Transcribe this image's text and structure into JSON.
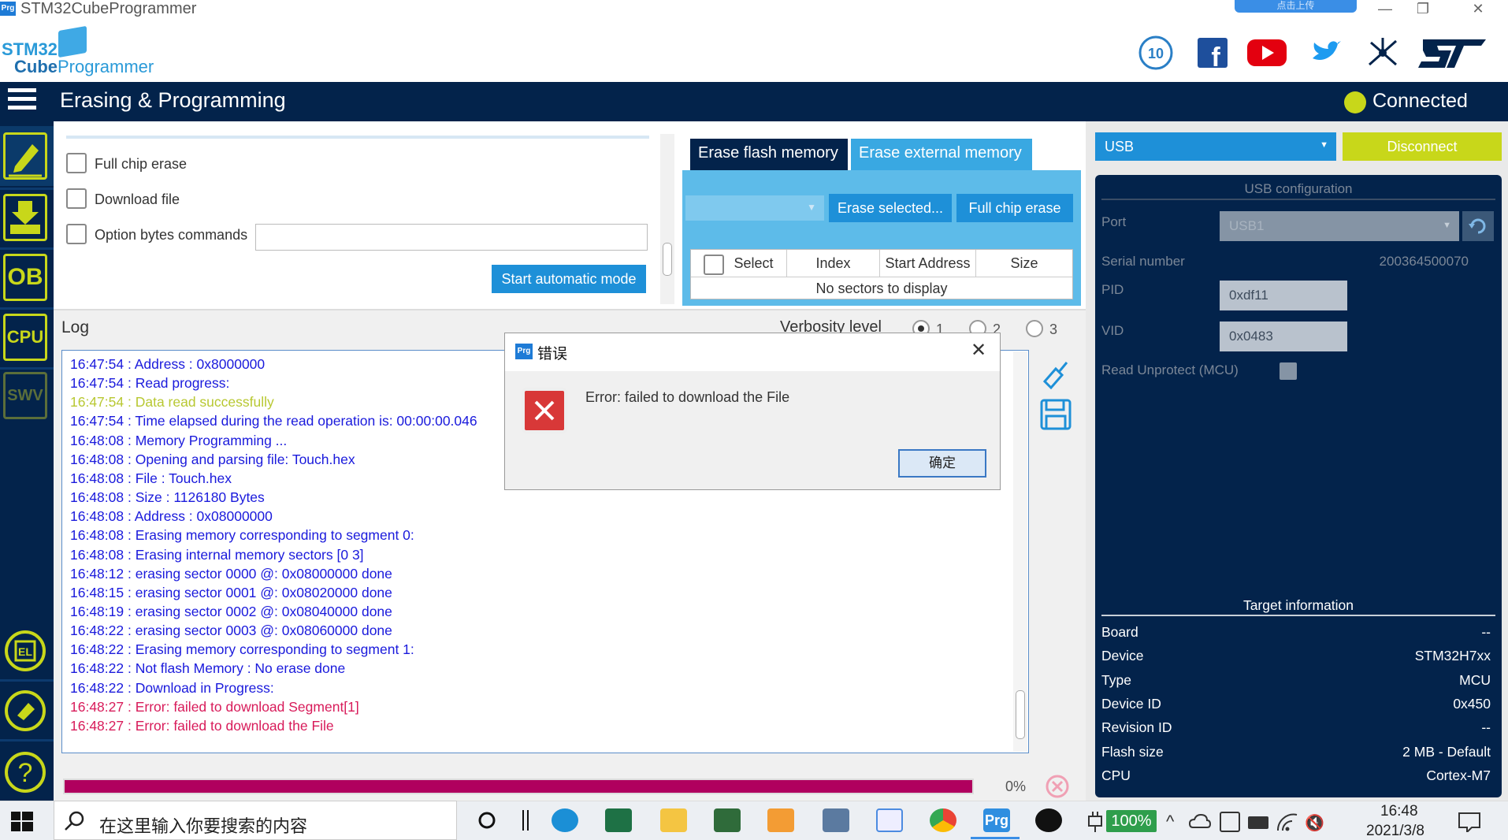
{
  "window": {
    "title": "STM32CubeProgrammer",
    "icon_label": "Prg",
    "cloud_badge": "点击上传"
  },
  "logo": {
    "line1": "STM32",
    "line2_bold": "Cube",
    "line2_rest": "Programmer"
  },
  "header_icons": [
    "anniversary-10-icon",
    "facebook-icon",
    "youtube-icon",
    "twitter-icon",
    "network-icon",
    "st-logo-icon"
  ],
  "navbar": {
    "title": "Erasing & Programming",
    "status": "Connected"
  },
  "sidebar": [
    {
      "name": "edit",
      "label": ""
    },
    {
      "name": "download",
      "label": ""
    },
    {
      "name": "ob",
      "label": "OB"
    },
    {
      "name": "cpu",
      "label": "CPU"
    },
    {
      "name": "swv",
      "label": "SWV"
    },
    {
      "name": "el",
      "label": "EL"
    },
    {
      "name": "eraser",
      "label": ""
    },
    {
      "name": "help",
      "label": "?"
    }
  ],
  "auto": {
    "full_chip_erase": "Full chip erase",
    "download_file": "Download file",
    "option_bytes": "Option bytes commands",
    "start_button": "Start automatic mode"
  },
  "erase": {
    "tab_flash": "Erase flash memory",
    "tab_external": "Erase external memory",
    "erase_selected": "Erase selected...",
    "full_chip_erase": "Full chip erase",
    "columns": [
      "Select",
      "Index",
      "Start Address",
      "Size"
    ],
    "empty_text": "No sectors to display"
  },
  "log": {
    "title": "Log",
    "verbosity_label": "Verbosity level",
    "levels": [
      "1",
      "2",
      "3"
    ],
    "selected_level": "1",
    "lines": [
      {
        "text": "16:47:54 :   Address       : 0x8000000",
        "color": "#1a1adc"
      },
      {
        "text": "16:47:54 : Read progress:",
        "color": "#1a1adc"
      },
      {
        "text": "16:47:54 : Data read successfully",
        "color": "#b8c832"
      },
      {
        "text": "16:47:54 : Time elapsed during the read operation is: 00:00:00.046",
        "color": "#1a1adc"
      },
      {
        "text": "16:48:08 : Memory Programming ...",
        "color": "#1a1adc"
      },
      {
        "text": "16:48:08 : Opening and parsing file: Touch.hex",
        "color": "#1a1adc"
      },
      {
        "text": "16:48:08 :   File          : Touch.hex",
        "color": "#1a1adc"
      },
      {
        "text": "16:48:08 :   Size          : 1126180 Bytes",
        "color": "#1a1adc"
      },
      {
        "text": "16:48:08 :   Address       : 0x08000000",
        "color": "#1a1adc"
      },
      {
        "text": "16:48:08 : Erasing memory corresponding to segment 0:",
        "color": "#1a1adc"
      },
      {
        "text": "16:48:08 : Erasing internal memory sectors [0 3]",
        "color": "#1a1adc"
      },
      {
        "text": "16:48:12 : erasing sector 0000 @: 0x08000000 done",
        "color": "#1a1adc"
      },
      {
        "text": "16:48:15 : erasing sector 0001 @: 0x08020000 done",
        "color": "#1a1adc"
      },
      {
        "text": "16:48:19 : erasing sector 0002 @: 0x08040000 done",
        "color": "#1a1adc"
      },
      {
        "text": "16:48:22 : erasing sector 0003 @: 0x08060000 done",
        "color": "#1a1adc"
      },
      {
        "text": "16:48:22 : Erasing memory corresponding to segment 1:",
        "color": "#1a1adc"
      },
      {
        "text": "16:48:22 : Not flash Memory : No erase done",
        "color": "#1a1adc"
      },
      {
        "text": "16:48:22 : Download in Progress:",
        "color": "#1a1adc"
      },
      {
        "text": "16:48:27 : Error: failed to download Segment[1]",
        "color": "#d81b5a"
      },
      {
        "text": "16:48:27 : Error: failed to download the File",
        "color": "#d81b5a"
      }
    ],
    "progress_fraction": 1.0,
    "progress_text": "0%"
  },
  "connection": {
    "interface": "USB",
    "disconnect": "Disconnect",
    "config_title": "USB configuration",
    "port_label": "Port",
    "port_value": "USB1",
    "serial_label": "Serial number",
    "serial_value": "200364500070",
    "pid_label": "PID",
    "pid_value": "0xdf11",
    "vid_label": "VID",
    "vid_value": "0x0483",
    "read_unprotect": "Read Unprotect (MCU)"
  },
  "target": {
    "title": "Target information",
    "rows": [
      {
        "label": "Board",
        "value": "--"
      },
      {
        "label": "Device",
        "value": "STM32H7xx"
      },
      {
        "label": "Type",
        "value": "MCU"
      },
      {
        "label": "Device ID",
        "value": "0x450"
      },
      {
        "label": "Revision ID",
        "value": "--"
      },
      {
        "label": "Flash size",
        "value": "2 MB - Default"
      },
      {
        "label": "CPU",
        "value": "Cortex-M7"
      }
    ]
  },
  "dialog": {
    "icon_label": "Prg",
    "title": "错误",
    "message": "Error: failed to download the File",
    "ok": "确定"
  },
  "taskbar": {
    "search_placeholder": "在这里输入你要搜索的内容",
    "battery": "100%",
    "time": "16:48",
    "date": "2021/3/8",
    "apps": [
      "cortana-icon",
      "task-view-icon",
      "edge-icon",
      "excel-icon",
      "explorer-icon",
      "vs-icon",
      "pdf-icon",
      "calculator-icon",
      "photos-icon",
      "chrome-icon",
      "prg-icon",
      "app-icon"
    ]
  },
  "colors": {
    "navy": "#03234b",
    "accent": "#1e90d8",
    "lime": "#c8d71a",
    "error": "#d81b5a"
  }
}
